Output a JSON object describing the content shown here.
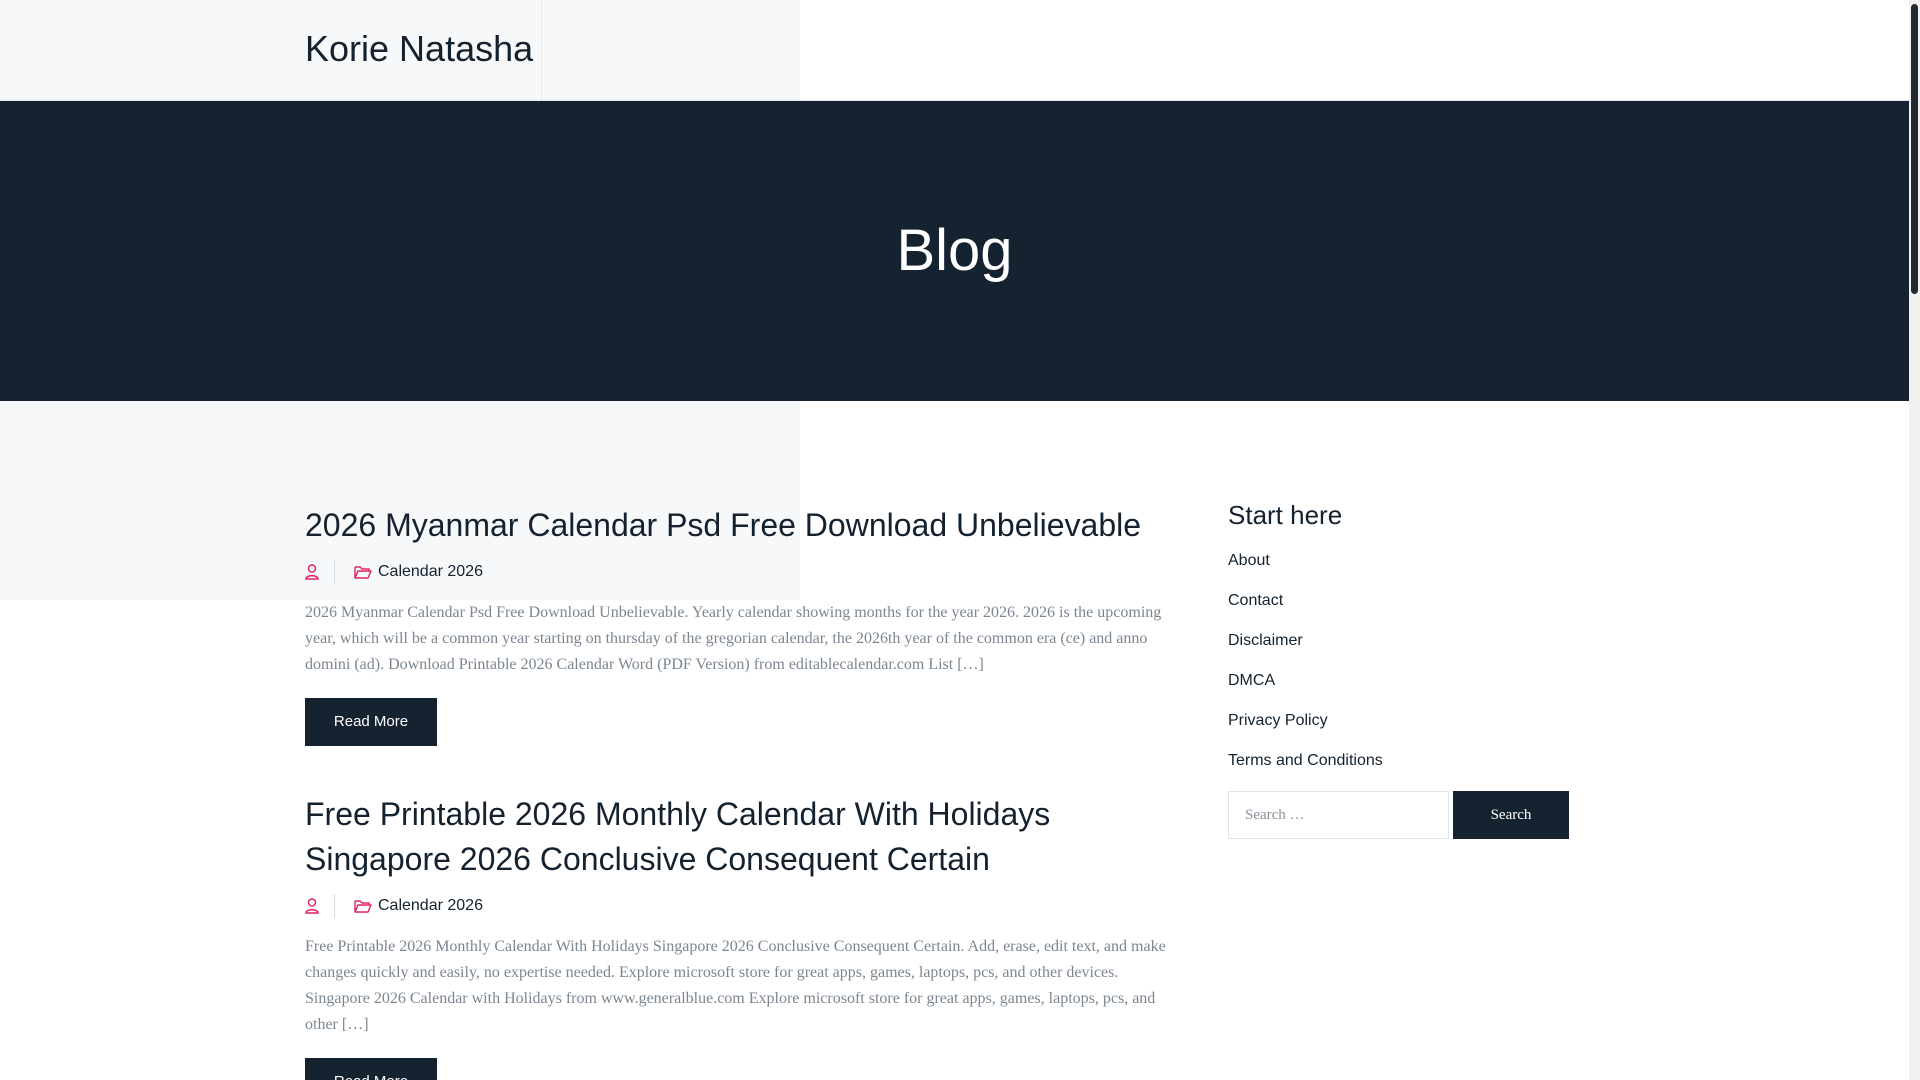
{
  "header": {
    "site_title": "Korie Natasha"
  },
  "hero": {
    "title": "Blog"
  },
  "posts": [
    {
      "title": "2026 Myanmar Calendar Psd Free Download Unbelievable",
      "category": "Calendar 2026",
      "excerpt": "2026 Myanmar Calendar Psd Free Download Unbelievable. Yearly calendar showing months for the year 2026. 2026 is the upcoming year, which will be a common year starting on thursday of the gregorian calendar, the 2026th year of the common era (ce) and anno domini (ad). Download Printable 2026 Calendar Word (PDF Version) from editablecalendar.com List […]",
      "read_more": "Read More"
    },
    {
      "title": "Free Printable 2026 Monthly Calendar With Holidays Singapore 2026 Conclusive Consequent Certain",
      "category": "Calendar 2026",
      "excerpt": "Free Printable 2026 Monthly Calendar With Holidays Singapore 2026 Conclusive Consequent Certain. Add, erase, edit text, and make changes quickly and easily, no expertise needed. Explore microsoft store for great apps, games, laptops, pcs, and other devices. Singapore 2026 Calendar with Holidays from www.generalblue.com Explore microsoft store for great apps, games, laptops, pcs, and other […]",
      "read_more": "Read More"
    }
  ],
  "sidebar": {
    "widget_title": "Start here",
    "links": [
      "About",
      "Contact",
      "Disclaimer",
      "DMCA",
      "Privacy Policy",
      "Terms and Conditions"
    ],
    "search_placeholder": "Search …",
    "search_button": "Search"
  },
  "icons": {
    "author": "user-icon",
    "category": "folder-icon"
  },
  "colors": {
    "dark": "#152330",
    "accent": "#e0245e",
    "text": "#14222f",
    "muted": "#7b8691"
  }
}
